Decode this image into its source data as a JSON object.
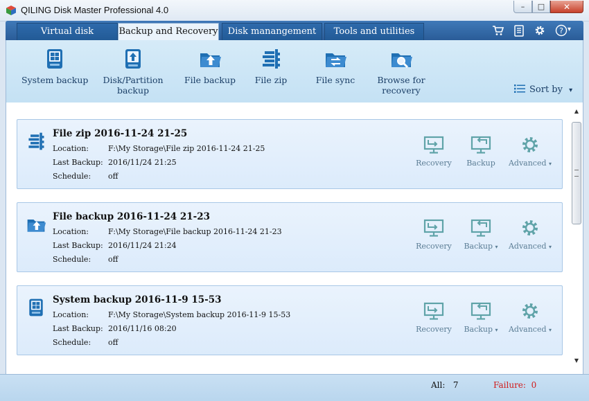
{
  "window": {
    "title": "QILING Disk Master Professional 4.0",
    "controls": {
      "minimize": "–",
      "maximize": "□",
      "close": "✕"
    }
  },
  "tabs": [
    {
      "label": "Virtual disk",
      "active": false
    },
    {
      "label": "Backup and Recovery",
      "active": true
    },
    {
      "label": "Disk manangement",
      "active": false
    },
    {
      "label": "Tools and utilities",
      "active": false
    }
  ],
  "top_icons": [
    "cart-icon",
    "clipboard-icon",
    "gear-icon",
    "help-icon"
  ],
  "help_caret": "▾",
  "ribbon": {
    "items": [
      {
        "label": "System backup",
        "icon": "windows-drive-icon"
      },
      {
        "label": "Disk/Partition backup",
        "icon": "disk-upload-icon"
      },
      {
        "label": "File backup",
        "icon": "folder-upload-icon"
      },
      {
        "label": "File zip",
        "icon": "zip-icon"
      },
      {
        "label": "File sync",
        "icon": "folder-sync-icon"
      },
      {
        "label": "Browse for recovery",
        "icon": "folder-search-icon"
      }
    ],
    "sort_by": "Sort by",
    "sort_caret": "▾"
  },
  "row_labels": {
    "location": "Location:",
    "last_backup": "Last Backup:",
    "schedule": "Schedule:"
  },
  "backups": [
    {
      "title": "File zip 2016-11-24 21-25",
      "icon": "zip-icon",
      "location": "F:\\My Storage\\File zip 2016-11-24 21-25",
      "last_backup": "2016/11/24 21:25",
      "schedule": "off",
      "actions": {
        "recovery": "Recovery",
        "backup": "Backup",
        "advanced": "Advanced"
      },
      "backup_has_caret": false
    },
    {
      "title": "File backup 2016-11-24 21-23",
      "icon": "folder-upload-icon",
      "location": "F:\\My Storage\\File backup 2016-11-24 21-23",
      "last_backup": "2016/11/24 21:24",
      "schedule": "off",
      "actions": {
        "recovery": "Recovery",
        "backup": "Backup",
        "advanced": "Advanced"
      },
      "backup_has_caret": true
    },
    {
      "title": "System backup 2016-11-9 15-53",
      "icon": "windows-drive-icon",
      "location": "F:\\My Storage\\System backup 2016-11-9 15-53",
      "last_backup": "2016/11/16 08:20",
      "schedule": "off",
      "actions": {
        "recovery": "Recovery",
        "backup": "Backup",
        "advanced": "Advanced"
      },
      "backup_has_caret": true
    }
  ],
  "caret": "▾",
  "status": {
    "all_label": "All:",
    "all_count": "7",
    "failure_label": "Failure:",
    "failure_count": "0"
  },
  "colors": {
    "tab_bar": "#2e6aab",
    "ribbon": "#cfe6f7",
    "icon_blue": "#1f6fb3",
    "action_teal": "#5fa3a8",
    "failure": "#d11a1a"
  }
}
